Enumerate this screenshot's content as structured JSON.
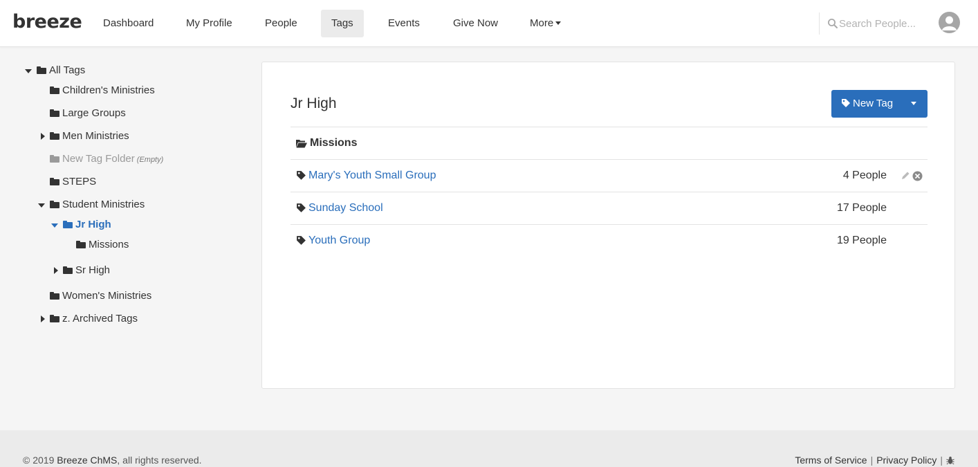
{
  "header": {
    "logo": "breeze",
    "nav": [
      {
        "label": "Dashboard"
      },
      {
        "label": "My Profile"
      },
      {
        "label": "People"
      },
      {
        "label": "Tags"
      },
      {
        "label": "Events"
      },
      {
        "label": "Give Now"
      },
      {
        "label": "More"
      }
    ],
    "active_nav": "Tags",
    "search_placeholder": "Search People..."
  },
  "tree": {
    "all_tags": "All Tags",
    "children_ministries": "Children's Ministries",
    "large_groups": "Large Groups",
    "men_ministries": "Men Ministries",
    "new_tag_folder": "New Tag Folder",
    "empty_note": "(Empty)",
    "steps": "STEPS",
    "student_ministries": "Student Ministries",
    "jr_high": "Jr High",
    "missions": "Missions",
    "sr_high": "Sr High",
    "women_ministries": "Women's Ministries",
    "archived_tags": "z. Archived Tags"
  },
  "panel": {
    "title": "Jr High",
    "new_tag_label": "New Tag",
    "folder_row": "Missions",
    "tags": [
      {
        "name": "Mary's Youth Small Group",
        "count": "4 People"
      },
      {
        "name": "Sunday School",
        "count": "17 People"
      },
      {
        "name": "Youth Group",
        "count": "19 People"
      }
    ]
  },
  "footer": {
    "copyright_prefix": "© 2019",
    "brand": "Breeze ChMS",
    "copyright_suffix": ", all rights reserved.",
    "terms": "Terms of Service",
    "privacy": "Privacy Policy",
    "separator": "|"
  },
  "colors": {
    "accent": "#2a6ebb",
    "text": "#333333",
    "muted": "#9a9a9a",
    "footer_bg": "#ebebeb"
  }
}
